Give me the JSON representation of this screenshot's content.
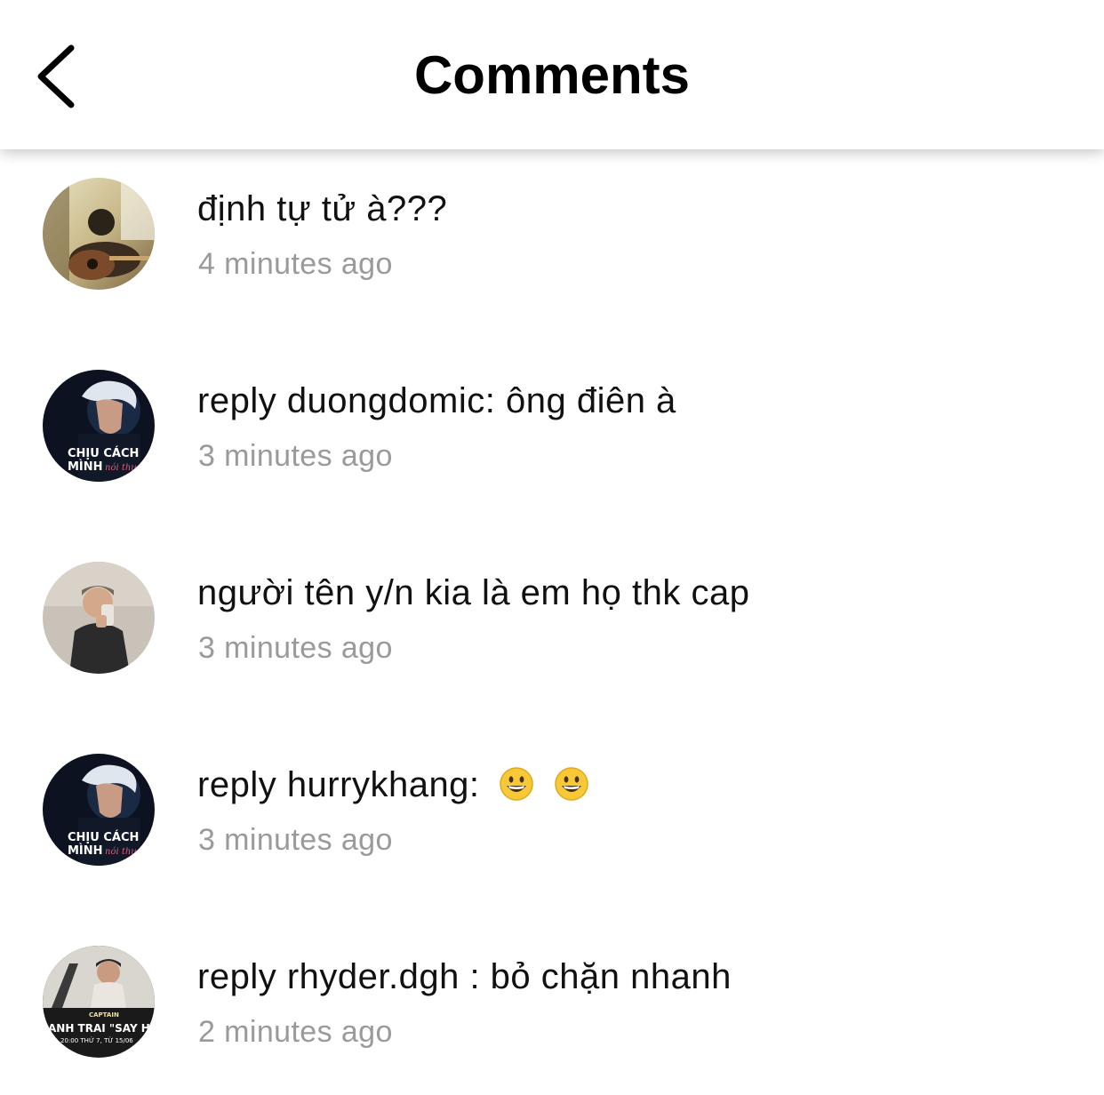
{
  "header": {
    "title": "Comments",
    "back_icon": "chevron-left-icon"
  },
  "comments": [
    {
      "text": "định tự tử à???",
      "time": "4 minutes ago",
      "avatar": "guitar-person-photo"
    },
    {
      "text": "reply duongdomic: ông điên à",
      "time": "3 minutes ago",
      "avatar": "album-cover-photo",
      "avatar_text_1": "CHỊU CÁCH",
      "avatar_text_2": "MÌNH",
      "avatar_text_3": "nói thua"
    },
    {
      "text": "người tên y/n kia là em họ thk cap",
      "time": "3 minutes ago",
      "avatar": "mirror-selfie-photo"
    },
    {
      "text": "reply hurrykhang:",
      "emoji": "grinning-face-emoji",
      "time": "3 minutes ago",
      "avatar": "album-cover-photo",
      "avatar_text_1": "CHỊU CÁCH",
      "avatar_text_2": "MÌNH",
      "avatar_text_3": "nói thua"
    },
    {
      "text": "reply rhyder.dgh : bỏ chặn nhanh",
      "time": "2 minutes ago",
      "avatar": "poster-photo",
      "avatar_text_1": "CAPTAIN",
      "avatar_text_2": "ANH TRAI \"SAY HI\"",
      "avatar_text_3": "20:00 THỨ 7, TỪ 15/06"
    }
  ],
  "colors": {
    "text": "#111111",
    "timestamp": "#9a9a9a",
    "background": "#ffffff"
  }
}
